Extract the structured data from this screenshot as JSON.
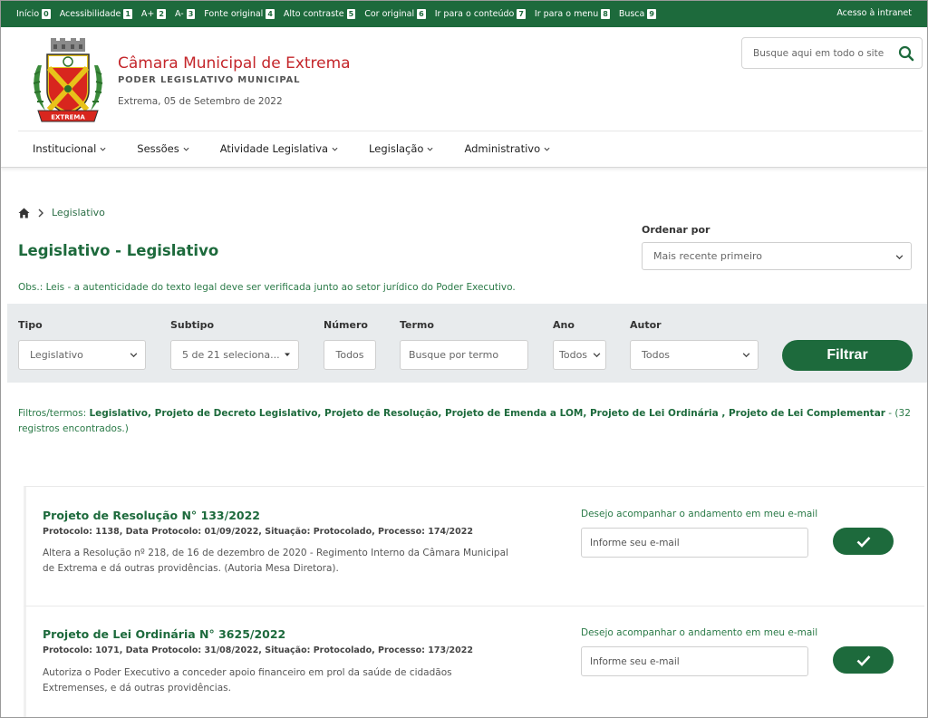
{
  "accessibility": {
    "items": [
      {
        "label": "Início",
        "key": "0"
      },
      {
        "label": "Acessibilidade",
        "key": "1"
      },
      {
        "label": "A+",
        "key": "2"
      },
      {
        "label": "A-",
        "key": "3"
      },
      {
        "label": "Fonte original",
        "key": "4"
      },
      {
        "label": "Alto contraste",
        "key": "5"
      },
      {
        "label": "Cor original",
        "key": "6"
      },
      {
        "label": "Ir para o conteúdo",
        "key": "7"
      },
      {
        "label": "Ir para o menu",
        "key": "8"
      },
      {
        "label": "Busca",
        "key": "9"
      }
    ],
    "intranet": "Acesso à intranet"
  },
  "header": {
    "logo_text": "EXTREMA",
    "title": "Câmara Municipal de Extrema",
    "subtitle": "PODER LEGISLATIVO MUNICIPAL",
    "date": "Extrema, 05 de Setembro de 2022",
    "search_placeholder": "Busque aqui em todo o site"
  },
  "nav": {
    "items": [
      "Institucional",
      "Sessões",
      "Atividade Legislativa",
      "Legislação",
      "Administrativo"
    ]
  },
  "breadcrumb": {
    "current": "Legislativo"
  },
  "page": {
    "title": "Legislativo - Legislativo",
    "obs": "Obs.: Leis - a autenticidade do texto legal deve ser verificada junto ao setor jurídico do Poder Executivo.",
    "order_label": "Ordenar por",
    "order_value": "Mais recente primeiro"
  },
  "filters": {
    "tipo_label": "Tipo",
    "tipo_value": "Legislativo",
    "subtipo_label": "Subtipo",
    "subtipo_value": "5 de 21 seleciona...",
    "numero_label": "Número",
    "numero_placeholder": "Todos",
    "termo_label": "Termo",
    "termo_placeholder": "Busque por termo",
    "ano_label": "Ano",
    "ano_value": "Todos",
    "autor_label": "Autor",
    "autor_value": "Todos",
    "button": "Filtrar"
  },
  "summary": {
    "prefix": "Filtros/termos: ",
    "terms": "Legislativo, Projeto de Decreto Legislativo, Projeto de Resolução, Projeto de Emenda a LOM, Projeto de Lei Ordinária , Projeto de Lei Complementar",
    "suffix": " - (32 registros encontrados.)"
  },
  "results": [
    {
      "title": "Projeto de Resolução N° 133/2022",
      "meta": "Protocolo: 1138, Data Protocolo: 01/09/2022, Situação: Protocolado, Processo: 174/2022",
      "description": "Altera a Resolução nº 218, de 16 de dezembro de 2020 - Regimento Interno da Câmara Municipal de Extrema e dá outras providências. (Autoria Mesa Diretora).",
      "follow_label": "Desejo acompanhar o andamento em meu e-mail",
      "email_placeholder": "Informe seu e-mail"
    },
    {
      "title": "Projeto de Lei Ordinária N° 3625/2022",
      "meta": "Protocolo: 1071, Data Protocolo: 31/08/2022, Situação: Protocolado, Processo: 173/2022",
      "description": "Autoriza o Poder Executivo a conceder apoio financeiro em prol da saúde de cidadãos Extremenses, e dá outras providências.",
      "follow_label": "Desejo acompanhar o andamento em meu e-mail",
      "email_placeholder": "Informe seu e-mail"
    }
  ],
  "colors": {
    "brand_green": "#1d6a3c",
    "title_red": "#c4262b",
    "filter_bg": "#e8ebed"
  },
  "icons": [
    "home-icon",
    "search-icon",
    "chevron-down-icon",
    "chevron-right-icon",
    "check-icon",
    "coat-of-arms-logo"
  ]
}
